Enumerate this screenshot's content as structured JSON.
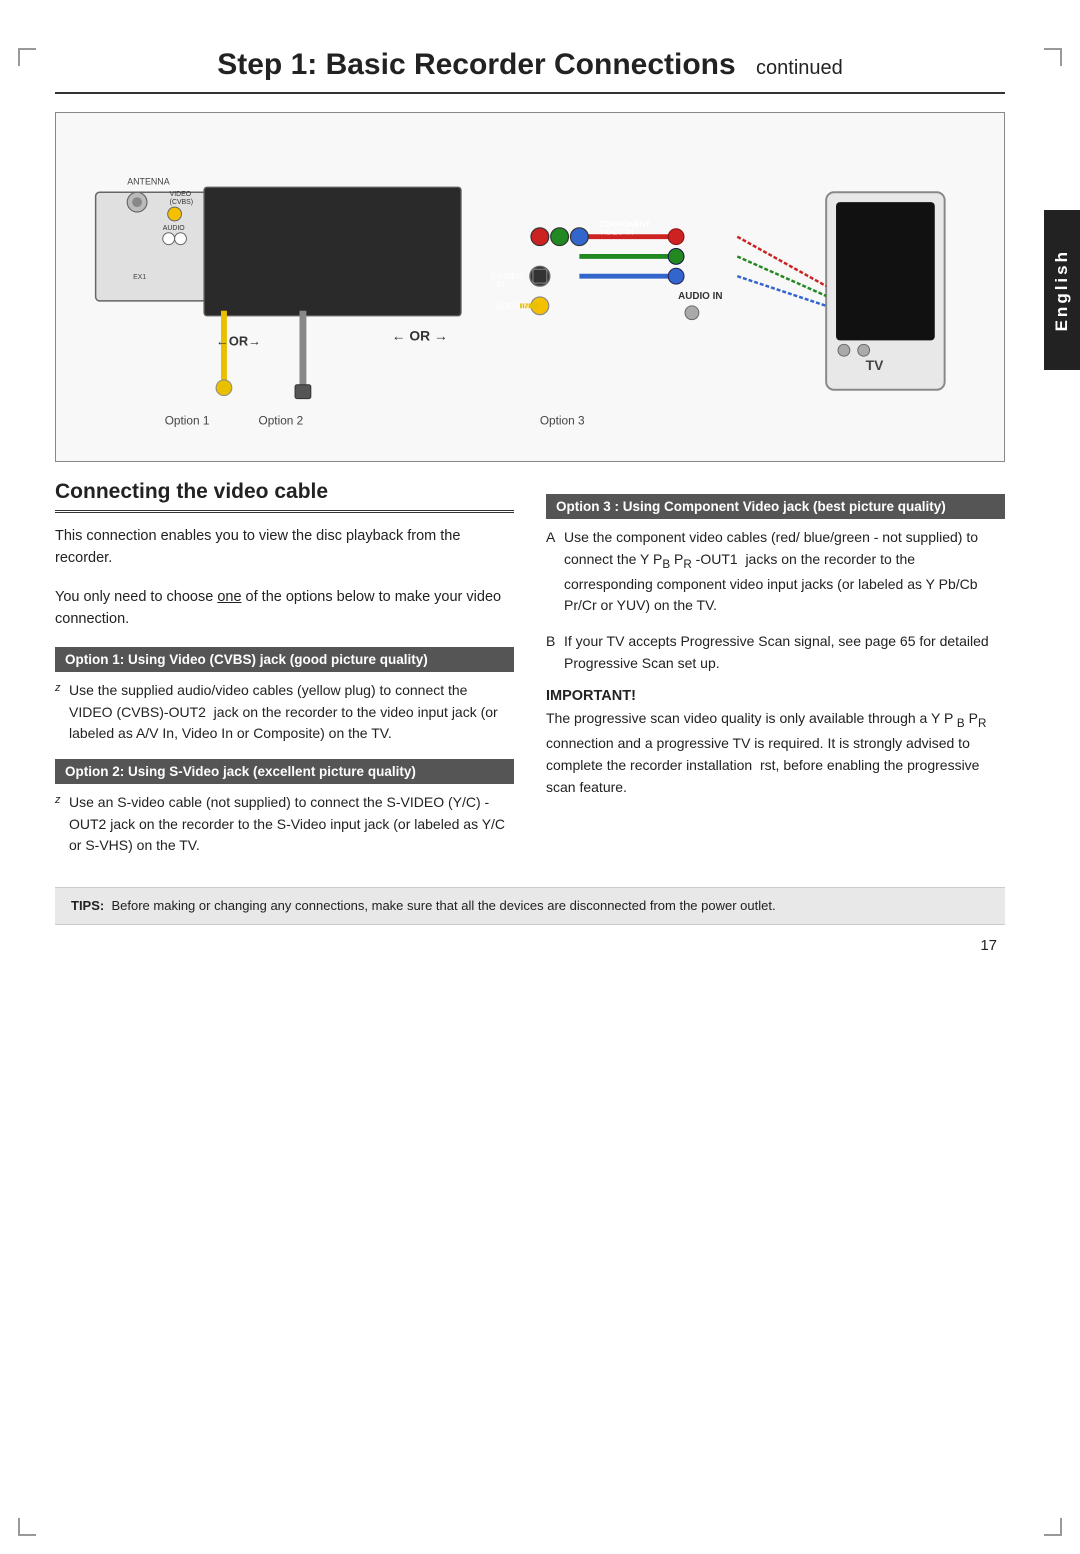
{
  "page": {
    "title": "Step 1: Basic Recorder Connections",
    "title_continued": "continued",
    "side_tab": "English",
    "page_number": "17"
  },
  "section": {
    "heading": "Connecting the video cable",
    "intro": [
      "This connection enables you to view the disc playback from the recorder.",
      "You only need to choose one of the options below to make your video connection."
    ],
    "intro_underline": "one"
  },
  "option1": {
    "label": "Option 1: Using Video (CVBS) jack (good picture quality)",
    "text": "Use the supplied audio/video cables (yellow plug) to connect the VIDEO (CVBS)-OUT2  jack on the recorder to the video input jack (or labeled as A/V In, Video In or Composite) on the TV."
  },
  "option2": {
    "label": "Option 2: Using S-Video jack (excellent picture quality)",
    "text": "Use an S-video cable (not supplied) to connect the S-VIDEO (Y/C) - OUT2 jack on the recorder to the S-Video input jack (or labeled as Y/C or S-VHS) on the TV."
  },
  "option3": {
    "label": "Option 3 : Using Component Video jack (best picture quality)",
    "text_a": "Use the component video cables (red/ blue/green - not supplied) to connect the Y PB PR -OUT1  jacks on the recorder to the corresponding component video input jacks (or labeled as Y Pb/Cb Pr/Cr or YUV) on the TV.",
    "text_b": "If your TV accepts Progressive Scan signal, see page 65 for detailed Progressive Scan set up."
  },
  "important": {
    "heading": "IMPORTANT!",
    "text": "The progressive scan video quality is only available through a Y P B PR connection and a progressive TV is required. It is strongly advised to complete the recorder installation  rst, before enabling the progressive scan feature."
  },
  "tips": {
    "label": "TIPS:",
    "text": "Before making or changing any connections, make sure that all the devices are disconnected from the power outlet."
  },
  "diagram": {
    "option1_label": "Option 1",
    "option2_label": "Option 2",
    "option3_label": "Option 3",
    "or_label": "OR",
    "or_arrow": "←OR→"
  }
}
